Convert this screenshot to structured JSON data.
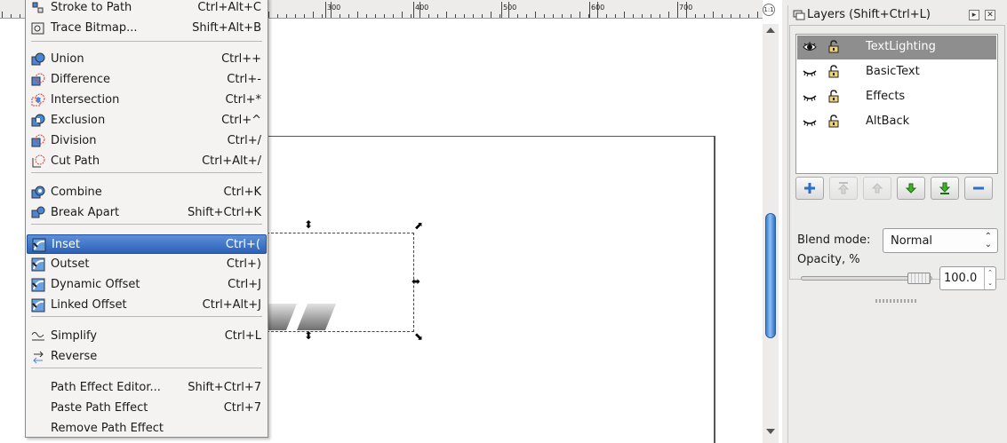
{
  "ruler": {
    "labels": [
      "300",
      "400",
      "500",
      "600",
      "700"
    ]
  },
  "zoom_corner_label": "1:1",
  "menu": {
    "items": [
      {
        "label": "Stroke to Path",
        "accel": "Ctrl+Alt+C",
        "icon": "stroke-to-path-icon"
      },
      {
        "label": "Trace Bitmap...",
        "accel": "Shift+Alt+B",
        "icon": "trace-bitmap-icon"
      },
      {
        "label": "Union",
        "accel": "Ctrl++",
        "icon": "union-icon"
      },
      {
        "label": "Difference",
        "accel": "Ctrl+-",
        "icon": "difference-icon"
      },
      {
        "label": "Intersection",
        "accel": "Ctrl+*",
        "icon": "intersection-icon"
      },
      {
        "label": "Exclusion",
        "accel": "Ctrl+^",
        "icon": "exclusion-icon"
      },
      {
        "label": "Division",
        "accel": "Ctrl+/",
        "icon": "division-icon"
      },
      {
        "label": "Cut Path",
        "accel": "Ctrl+Alt+/",
        "icon": "cut-path-icon"
      },
      {
        "label": "Combine",
        "accel": "Ctrl+K",
        "icon": "combine-icon"
      },
      {
        "label": "Break Apart",
        "accel": "Shift+Ctrl+K",
        "icon": "break-apart-icon"
      },
      {
        "label": "Inset",
        "accel": "Ctrl+(",
        "icon": "inset-icon",
        "active": true
      },
      {
        "label": "Outset",
        "accel": "Ctrl+)",
        "icon": "outset-icon"
      },
      {
        "label": "Dynamic Offset",
        "accel": "Ctrl+J",
        "icon": "dynamic-offset-icon"
      },
      {
        "label": "Linked Offset",
        "accel": "Ctrl+Alt+J",
        "icon": "linked-offset-icon"
      },
      {
        "label": "Simplify",
        "accel": "Ctrl+L",
        "icon": "simplify-icon"
      },
      {
        "label": "Reverse",
        "accel": "",
        "icon": "reverse-icon"
      },
      {
        "label": "Path Effect Editor...",
        "accel": "Shift+Ctrl+7",
        "icon": ""
      },
      {
        "label": "Paste Path Effect",
        "accel": "Ctrl+7",
        "icon": ""
      },
      {
        "label": "Remove Path Effect",
        "accel": "",
        "icon": ""
      }
    ]
  },
  "layers_panel": {
    "title": "Layers (Shift+Ctrl+L)",
    "layers": [
      {
        "name": "TextLighting",
        "visible": true,
        "selected": true
      },
      {
        "name": "BasicText",
        "visible": false,
        "selected": false
      },
      {
        "name": "Effects",
        "visible": false,
        "selected": false
      },
      {
        "name": "AltBack",
        "visible": false,
        "selected": false
      }
    ],
    "buttons": [
      {
        "name": "add-layer-button",
        "icon": "plus-icon",
        "enabled": true
      },
      {
        "name": "raise-layer-to-top-button",
        "icon": "raise-to-top-icon",
        "enabled": false
      },
      {
        "name": "raise-layer-button",
        "icon": "raise-icon",
        "enabled": false
      },
      {
        "name": "lower-layer-button",
        "icon": "lower-icon",
        "enabled": true
      },
      {
        "name": "lower-layer-to-bottom-button",
        "icon": "lower-to-bottom-icon",
        "enabled": true
      },
      {
        "name": "delete-layer-button",
        "icon": "minus-icon",
        "enabled": true
      }
    ],
    "blend_label": "Blend mode:",
    "blend_value": "Normal",
    "opacity_label": "Opacity, %",
    "opacity_value": "100.0",
    "opacity_fraction": 1.0
  },
  "colors": {
    "accent": "#2c61b8",
    "selected_row": "#8e8e8e",
    "green_arrow": "#2f9a1a"
  }
}
